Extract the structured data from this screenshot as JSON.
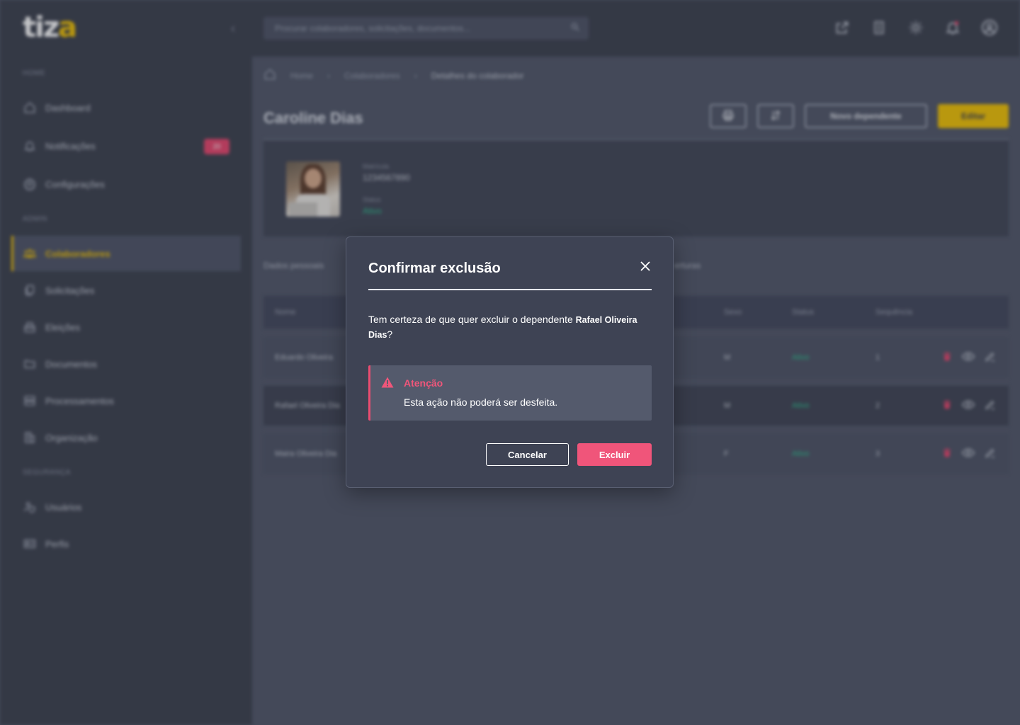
{
  "brand": {
    "logo_main": "tiz",
    "logo_accent": "a"
  },
  "search": {
    "placeholder": "Procurar colaboradores, solicitações, documentos..."
  },
  "sidebar": {
    "sections": [
      "HOME",
      "ADMIN",
      "SEGURANÇA"
    ],
    "items": [
      {
        "label": "Dashboard",
        "icon": "home-icon"
      },
      {
        "label": "Notificações",
        "icon": "bell-icon",
        "badge": "20"
      },
      {
        "label": "Configurações",
        "icon": "gear-icon"
      },
      {
        "label": "Colaboradores",
        "icon": "users-icon",
        "active": true
      },
      {
        "label": "Solicitações",
        "icon": "requests-icon"
      },
      {
        "label": "Eleições",
        "icon": "ballot-icon"
      },
      {
        "label": "Documentos",
        "icon": "folder-icon"
      },
      {
        "label": "Processamentos",
        "icon": "server-icon"
      },
      {
        "label": "Organização",
        "icon": "building-icon"
      },
      {
        "label": "Usuários",
        "icon": "user-shield-icon"
      },
      {
        "label": "Perfis",
        "icon": "id-card-icon"
      }
    ]
  },
  "breadcrumb": [
    "Home",
    "Colaboradores",
    "Detalhes do colaborador"
  ],
  "page": {
    "title": "Caroline Dias",
    "buttons": {
      "new_dependent": "Novo dependente",
      "edit": "Editar"
    }
  },
  "profile": {
    "registration_label": "Matrícula",
    "registration": "1234567890",
    "status_label": "Status",
    "status": "Ativo"
  },
  "tabs": [
    "Dados pessoais",
    "erturas"
  ],
  "table": {
    "headers": [
      "Nome",
      "Sexo",
      "Status",
      "Sequência"
    ],
    "rows": [
      {
        "name": "Eduardo Oliveira",
        "sex": "M",
        "status": "Ativo",
        "seq": "1"
      },
      {
        "name": "Rafael Oliveira Dia",
        "sex": "M",
        "status": "Ativo",
        "seq": "2"
      },
      {
        "name": "Maira Oliveira Dia",
        "sex": "F",
        "status": "Ativo",
        "seq": "3"
      }
    ]
  },
  "modal": {
    "title": "Confirmar exclusão",
    "message_prefix": "Tem certeza de que quer excluir o dependente ",
    "dependent_name": "Rafael Oliveira Dias",
    "message_suffix": "?",
    "alert_title": "Atenção",
    "alert_text": "Esta ação não poderá ser desfeita.",
    "cancel_label": "Cancelar",
    "delete_label": "Excluir"
  },
  "colors": {
    "accent": "#f2c200",
    "danger": "#f0557a",
    "success": "#2bc08d",
    "modal_bg": "#3e4354"
  }
}
